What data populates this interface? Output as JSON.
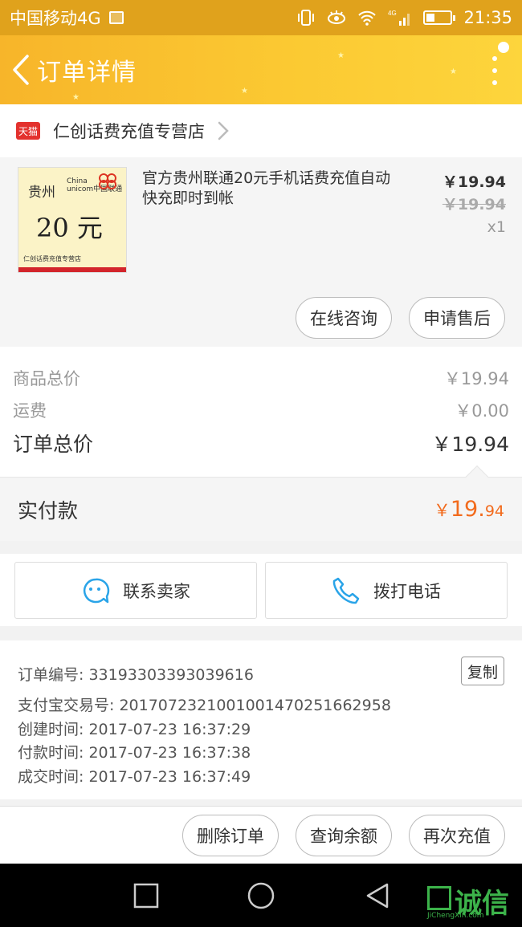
{
  "status_bar": {
    "carrier": "中国移动4G",
    "network": "4G",
    "time": "21:35"
  },
  "nav": {
    "title": "订单详情"
  },
  "shop": {
    "badge": "天猫",
    "name": "仁创话费充值专营店"
  },
  "product": {
    "thumb": {
      "province": "贵州",
      "brand_line1": "China",
      "brand_line2": "unicom中国联通",
      "amount": "20 元",
      "footer": "仁创话费充值专营店"
    },
    "title": "官方贵州联通20元手机话费充值自动快充即时到帐",
    "price": "￥19.94",
    "original_price": "￥19.94",
    "quantity": "x1",
    "consult_label": "在线咨询",
    "aftersale_label": "申请售后"
  },
  "totals": {
    "goods_label": "商品总价",
    "goods_value": "￥19.94",
    "shipping_label": "运费",
    "shipping_value": "￥0.00",
    "order_label": "订单总价",
    "order_value": "￥19.94"
  },
  "paid": {
    "label": "实付款",
    "symbol": "￥",
    "integer": "19.",
    "decimal": "94"
  },
  "contact": {
    "seller_label": "联系卖家",
    "phone_label": "拨打电话"
  },
  "info": {
    "order_no": "订单编号: 33193303393039616",
    "alipay_no": "支付宝交易号: 2017072321001001470251662958",
    "created": "创建时间: 2017-07-23 16:37:29",
    "paid": "付款时间: 2017-07-23 16:37:38",
    "closed": "成交时间: 2017-07-23 16:37:49",
    "copy_label": "复制"
  },
  "actions": {
    "delete_label": "删除订单",
    "balance_label": "查询余额",
    "recharge_label": "再次充值"
  },
  "watermark": {
    "text": "诚信",
    "sub": "JiChengXin.com"
  },
  "colors": {
    "nav_bg": "#fbc932",
    "status_bg": "#e0a21c",
    "paid_accent": "#f26b1d",
    "tmall_red": "#e3312d",
    "chat_blue": "#2aa4e8"
  }
}
